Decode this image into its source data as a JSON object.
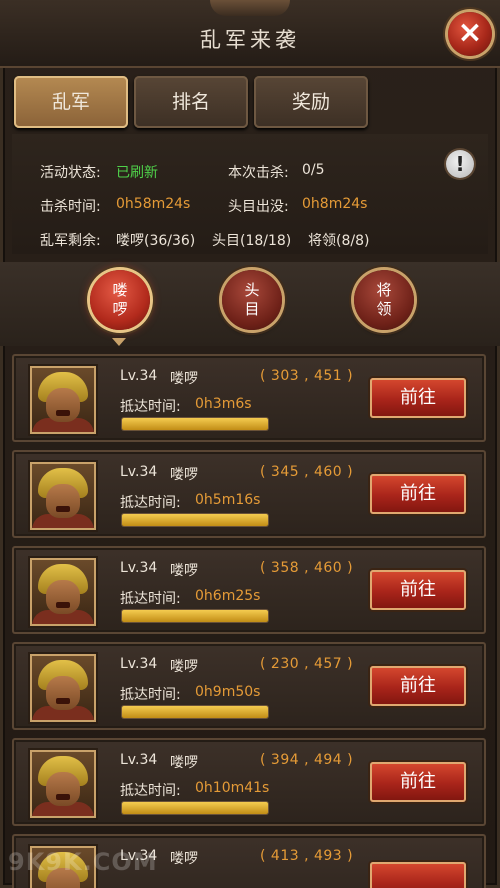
{
  "window": {
    "title": "乱军来袭",
    "close_icon": "×"
  },
  "tabs": [
    {
      "label": "乱军",
      "active": true
    },
    {
      "label": "排名",
      "active": false
    },
    {
      "label": "奖励",
      "active": false
    }
  ],
  "info": {
    "status_label": "活动状态:",
    "status_value": "已刷新",
    "kills_label": "本次击杀:",
    "kills_value": "0/5",
    "kill_time_label": "击杀时间:",
    "kill_time_value": "0h58m24s",
    "boss_label": "头目出没:",
    "boss_value": "0h8m24s",
    "remain_label": "乱军剩余:",
    "remain_minion": "喽啰(36/36)",
    "remain_boss": "头目(18/18)",
    "remain_general": "将领(8/8)",
    "alert_icon": "!"
  },
  "filters": [
    {
      "label": "喽啰",
      "selected": true
    },
    {
      "label": "头目",
      "selected": false
    },
    {
      "label": "将领",
      "selected": false
    }
  ],
  "rows": [
    {
      "level": "Lv.34",
      "name": "喽啰",
      "coord": "( 303 , 451 )",
      "arrival_label": "抵达时间:",
      "arrival": "0h3m6s",
      "button": "前往",
      "progress": 1.0
    },
    {
      "level": "Lv.34",
      "name": "喽啰",
      "coord": "( 345 , 460 )",
      "arrival_label": "抵达时间:",
      "arrival": "0h5m16s",
      "button": "前往",
      "progress": 1.0
    },
    {
      "level": "Lv.34",
      "name": "喽啰",
      "coord": "( 358 , 460 )",
      "arrival_label": "抵达时间:",
      "arrival": "0h6m25s",
      "button": "前往",
      "progress": 1.0
    },
    {
      "level": "Lv.34",
      "name": "喽啰",
      "coord": "( 230 , 457 )",
      "arrival_label": "抵达时间:",
      "arrival": "0h9m50s",
      "button": "前往",
      "progress": 1.0
    },
    {
      "level": "Lv.34",
      "name": "喽啰",
      "coord": "( 394 , 494 )",
      "arrival_label": "抵达时间:",
      "arrival": "0h10m41s",
      "button": "前往",
      "progress": 1.0
    },
    {
      "level": "Lv.34",
      "name": "喽啰",
      "coord": "( 413 , 493 )",
      "arrival_label": "",
      "arrival": "",
      "button": "",
      "progress": 1.0
    }
  ],
  "watermark": "9K9K.COM"
}
